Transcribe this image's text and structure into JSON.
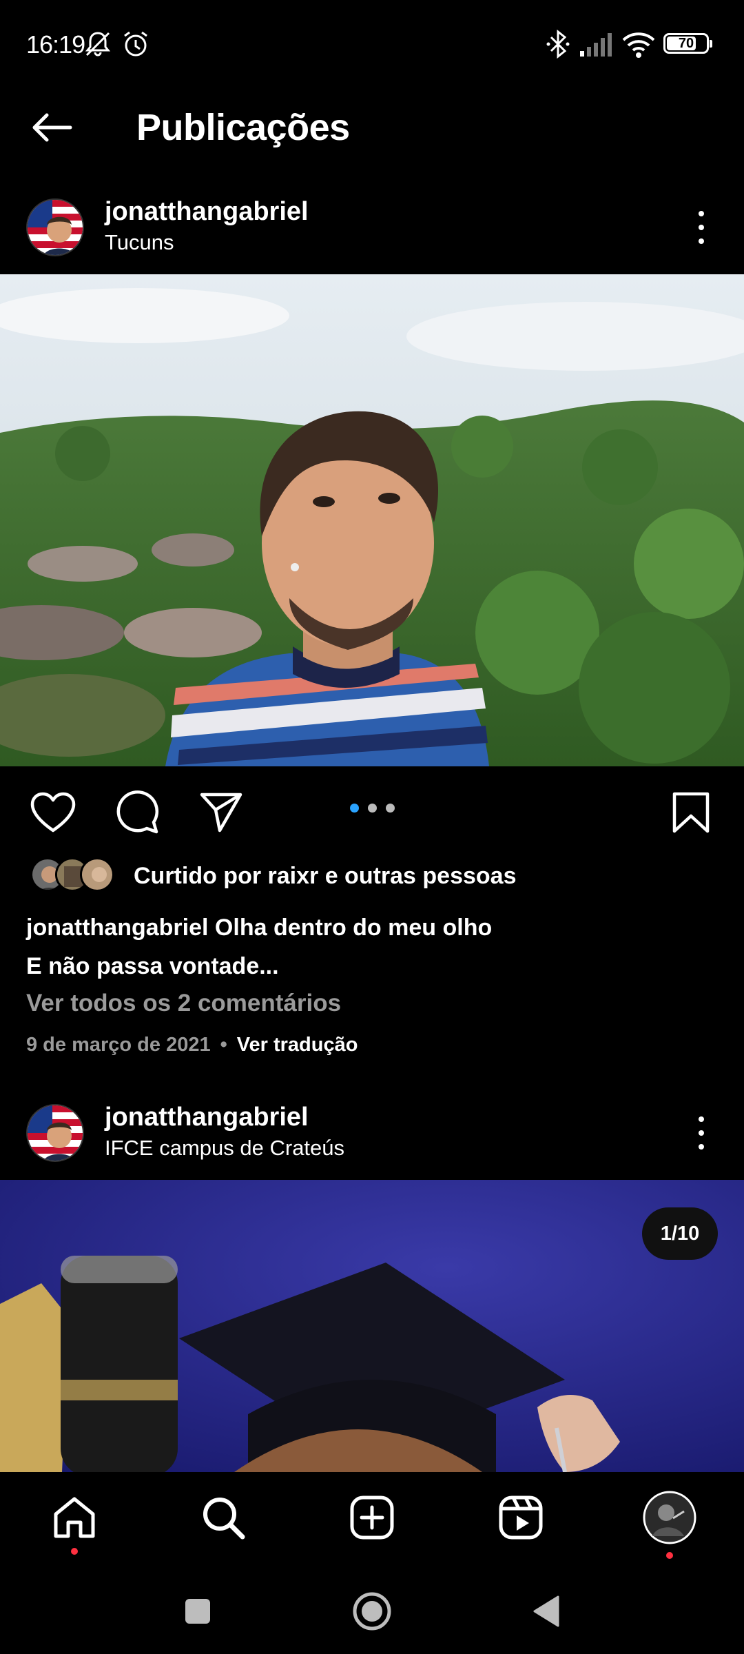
{
  "status_bar": {
    "time": "16:19",
    "battery_level": "70",
    "icons": [
      "mute-icon",
      "alarm-icon",
      "bluetooth-icon",
      "signal-icon",
      "wifi-icon",
      "battery-icon"
    ]
  },
  "header": {
    "title": "Publicações"
  },
  "posts": [
    {
      "username": "jonatthangabriel",
      "location": "Tucuns",
      "carousel_dots": 3,
      "carousel_active": 0,
      "likes_text": "Curtido por raixr e outras pessoas",
      "caption_user": "jonatthangabriel",
      "caption_line1": "Olha dentro do meu olho",
      "caption_line2": "E não passa vontade...",
      "comments_link": "Ver todos os 2 comentários",
      "date": "9 de março de 2021",
      "separator": "•",
      "translate_label": "Ver tradução"
    },
    {
      "username": "jonatthangabriel",
      "location": "IFCE campus de Crateús",
      "counter": "1/10"
    }
  ],
  "bottom_nav": {
    "items": [
      "home-icon",
      "search-icon",
      "create-post-icon",
      "reels-icon",
      "profile-avatar"
    ]
  },
  "colors": {
    "background": "#000000",
    "accent_blue": "#2aa3ff",
    "notification_red": "#ff3040",
    "secondary_text": "#9a9a9a"
  }
}
